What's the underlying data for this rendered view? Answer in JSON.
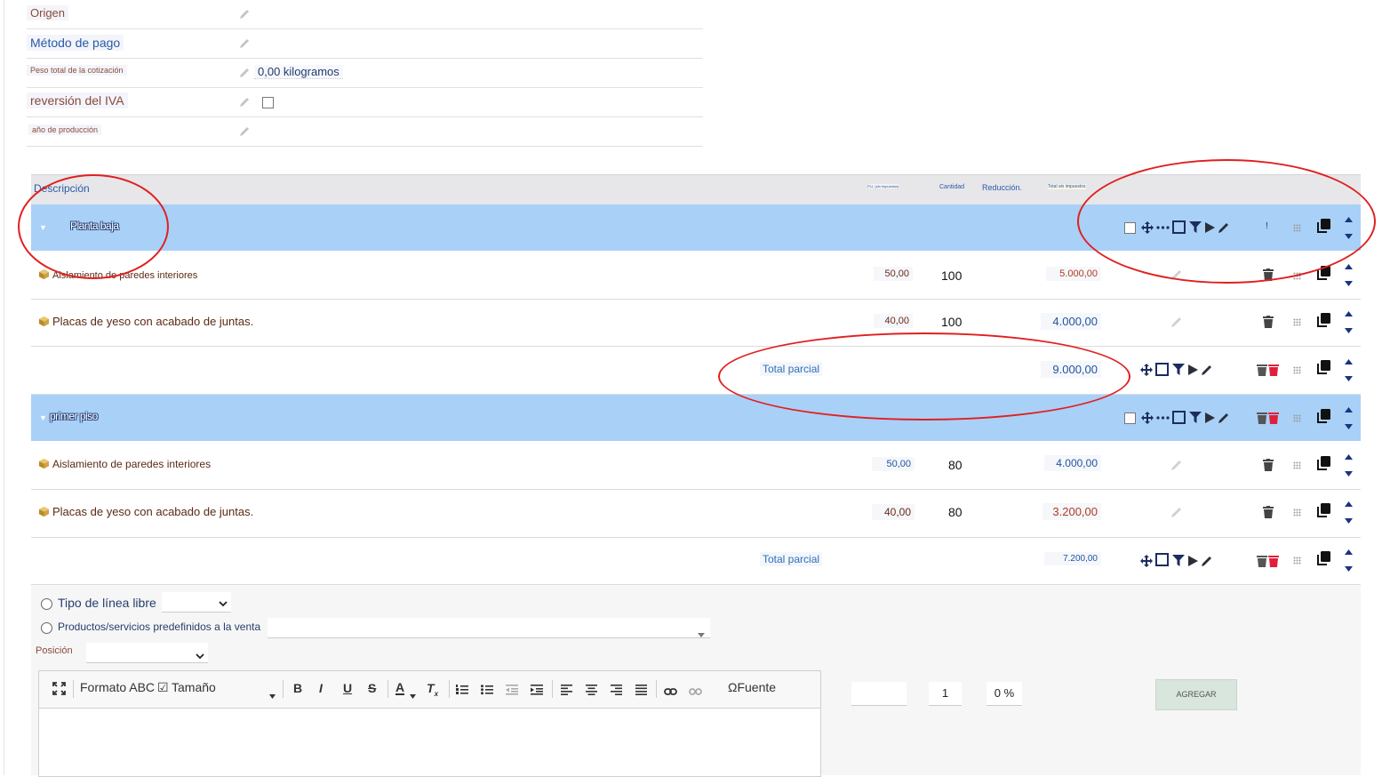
{
  "properties": [
    {
      "label": "Origen",
      "value": ""
    },
    {
      "label": "Método de pago",
      "value": ""
    },
    {
      "label": "Peso total de la cotización",
      "value": "0,00 kilogramos"
    },
    {
      "label": "reversión del IVA",
      "value": ""
    },
    {
      "label": "año de producción",
      "value": ""
    }
  ],
  "table": {
    "headers": {
      "description": "Descripción",
      "unit_price": "P.U. (sin impuestos)",
      "quantity": "Cantidad",
      "discount": "Reducción.",
      "total": "Total sin impuestos"
    }
  },
  "groups": [
    {
      "name": "Planta baja",
      "lines": [
        {
          "description": "Aislamiento de paredes interiores",
          "price": "50,00",
          "qty": "100",
          "total": "5.000,00"
        },
        {
          "description": "Placas de yeso con acabado de juntas.",
          "price": "40,00",
          "qty": "100",
          "total": "4.000,00"
        }
      ],
      "subtotal_label": "Total parcial",
      "subtotal": "9.000,00"
    },
    {
      "name": "primer piso",
      "lines": [
        {
          "description": "Aislamiento de paredes interiores",
          "price": "50,00",
          "qty": "80",
          "total": "4.000,00"
        },
        {
          "description": "Placas de yeso con acabado de juntas.",
          "price": "40,00",
          "qty": "80",
          "total": "3.200,00"
        }
      ],
      "subtotal_label": "Total parcial",
      "subtotal": "7.200,00"
    }
  ],
  "add_line": {
    "free_line_label": "Tipo de línea libre",
    "predefined_label": "Productos/servicios predefinidos a la venta",
    "position_label": "Posición",
    "editor": {
      "format": "Formato ABC",
      "size_checkbox": "☑",
      "size": "Tamaño",
      "font": "ΩFuente"
    },
    "qty_value": "1",
    "discount_value": "0",
    "percent": "%",
    "add_button": "AGREGAR"
  },
  "colors": {
    "group_bar": "#a9d0f7",
    "header_bar": "#e7e7e9",
    "icon_navy": "#1b2d5e",
    "delete_red": "#e0203a",
    "annotation": "#e02020"
  }
}
